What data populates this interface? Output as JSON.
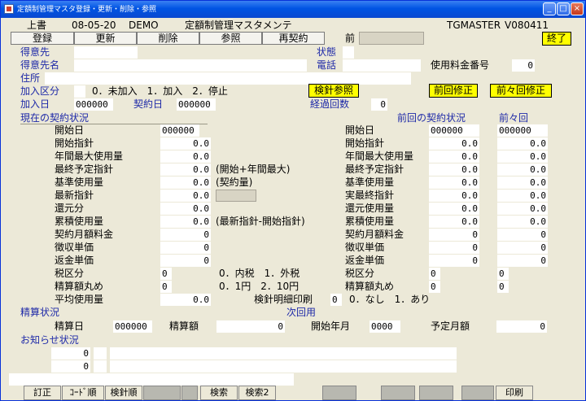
{
  "window": {
    "title": "定額制管理マスタ登録・更新・削除・参照",
    "minimize": "_",
    "maximize": "□",
    "close": "×"
  },
  "header": {
    "mode": "上書",
    "date": "08-05-20",
    "company": "DEMO",
    "screen_title": "定額制管理マスタメンテ",
    "program": "TGMASTER",
    "version": "V080411"
  },
  "tabs": [
    {
      "label": "登録"
    },
    {
      "label": "更新"
    },
    {
      "label": "削除"
    },
    {
      "label": "参照"
    },
    {
      "label": "再契約"
    }
  ],
  "prev_label": "前",
  "prev_value": "",
  "exit_label": "終了",
  "labels": {
    "customer": "得意先",
    "status": "状態",
    "customer_name": "得意先名",
    "phone": "電話",
    "fee_no": "使用料金番号",
    "address": "住所",
    "join_type": "加入区分",
    "join_type_note": "0．未加入　1．加入　2．停止",
    "join_date": "加入日",
    "contract_date": "契約日",
    "elapsed": "経過回数",
    "current_contract": "現在の契約状況",
    "prev_contract": "前回の契約状況",
    "prev_prev": "前々回",
    "settlement": "精算状況",
    "settle_date": "精算日",
    "settle_amount": "精算額",
    "next_use": "次回用",
    "start_ym": "開始年月",
    "scheduled_monthly": "予定月額",
    "notice": "お知らせ状況"
  },
  "values": {
    "customer": "",
    "status": "",
    "customer_name": "",
    "phone": "",
    "fee_no": "0",
    "address": "",
    "join_type": "",
    "join_date": "000000",
    "contract_date": "000000",
    "elapsed": "0",
    "settle_date": "000000",
    "settle_amount": "0",
    "start_ym": "0000",
    "scheduled_monthly": "0"
  },
  "buttons": {
    "meter_ref": "検針参照",
    "prev_fix": "前回修正",
    "prev_prev_fix": "前々回修正"
  },
  "current": [
    {
      "label": "開始日",
      "value": "000000",
      "note": ""
    },
    {
      "label": "開始指針",
      "value": "0.0",
      "note": ""
    },
    {
      "label": "年間最大使用量",
      "value": "0.0",
      "note": ""
    },
    {
      "label": "最終予定指針",
      "value": "0.0",
      "note": "(開始+年間最大)"
    },
    {
      "label": "基準使用量",
      "value": "0.0",
      "note": "(契約量)"
    },
    {
      "label": "最新指針",
      "value": "0.0",
      "note": ""
    },
    {
      "label": "還元分",
      "value": "0.0",
      "note": ""
    },
    {
      "label": "累積使用量",
      "value": "0.0",
      "note": "(最新指針-開始指針)"
    },
    {
      "label": "契約月額料金",
      "value": "0",
      "note": ""
    },
    {
      "label": "徴収単価",
      "value": "0",
      "note": ""
    },
    {
      "label": "返金単価",
      "value": "0",
      "note": ""
    }
  ],
  "previous": [
    {
      "label": "開始日",
      "v1": "000000",
      "v2": "000000"
    },
    {
      "label": "開始指針",
      "v1": "0.0",
      "v2": "0.0"
    },
    {
      "label": "年間最大使用量",
      "v1": "0.0",
      "v2": "0.0"
    },
    {
      "label": "最終予定指針",
      "v1": "0.0",
      "v2": "0.0"
    },
    {
      "label": "基準使用量",
      "v1": "0.0",
      "v2": "0.0"
    },
    {
      "label": "実最終指針",
      "v1": "0.0",
      "v2": "0.0"
    },
    {
      "label": "還元使用量",
      "v1": "0.0",
      "v2": "0.0"
    },
    {
      "label": "累積使用量",
      "v1": "0.0",
      "v2": "0.0"
    },
    {
      "label": "契約月額料金",
      "v1": "0",
      "v2": "0"
    },
    {
      "label": "徴収単価",
      "v1": "0",
      "v2": "0"
    },
    {
      "label": "返金単価",
      "v1": "0",
      "v2": "0"
    }
  ],
  "tax": {
    "label": "税区分",
    "value": "0",
    "note": "0．内税　1．外税",
    "prev_label": "税区分",
    "p1": "0",
    "p2": "0"
  },
  "rounding": {
    "label": "精算額丸め",
    "value": "0",
    "note": "0．1円　2．10円",
    "prev_label": "精算額丸め",
    "p1": "0",
    "p2": "0"
  },
  "avg": {
    "label": "平均使用量",
    "value": "0.0"
  },
  "meter_print": {
    "label": "検針明細印刷",
    "value": "0",
    "note": "0．なし　1．あり"
  },
  "notices": [
    {
      "value": "0",
      "text": ""
    },
    {
      "value": "0",
      "text": ""
    }
  ],
  "fkeys": [
    {
      "label": "訂正"
    },
    {
      "label": "ｺｰﾄﾞ順"
    },
    {
      "label": "検針順"
    },
    {
      "label": ""
    },
    {
      "label": ""
    },
    {
      "label": "検索"
    },
    {
      "label": "検索2"
    },
    {
      "label": ""
    },
    {
      "label": ""
    },
    {
      "label": ""
    },
    {
      "label": ""
    },
    {
      "label": "印刷"
    }
  ]
}
